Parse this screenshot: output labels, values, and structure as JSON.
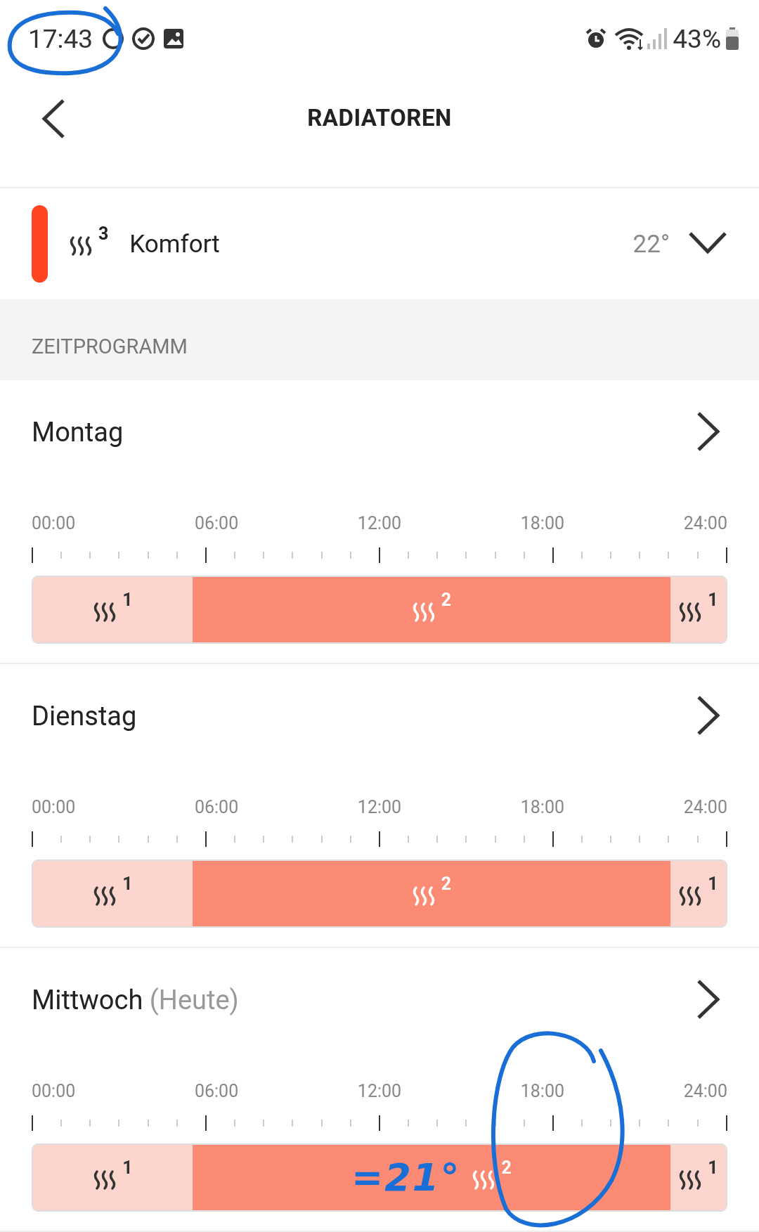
{
  "status_bar": {
    "time": "17:43",
    "battery": "43%"
  },
  "header": {
    "title": "RADIATOREN"
  },
  "current_mode": {
    "color": "#ff4422",
    "mode": "3",
    "label": "Komfort",
    "temperature": "22°",
    "expanded": false
  },
  "section_title": "ZEITPROGRAMM",
  "days": [
    {
      "day": "Montag",
      "time_labels": [
        "00:00",
        "06:00",
        "12:00",
        "18:00",
        "24:00"
      ],
      "segments": [
        {
          "kind": "early",
          "mode": "1"
        },
        {
          "kind": "day",
          "mode": "2"
        },
        {
          "kind": "late",
          "mode": "1"
        }
      ]
    },
    {
      "day": "Dienstag",
      "time_labels": [
        "00:00",
        "06:00",
        "12:00",
        "18:00",
        "24:00"
      ],
      "segments": [
        {
          "kind": "early",
          "mode": "1"
        },
        {
          "kind": "day",
          "mode": "2"
        },
        {
          "kind": "late",
          "mode": "1"
        }
      ]
    },
    {
      "day": "Mittwoch",
      "note": "(Heute)",
      "time_labels": [
        "00:00",
        "06:00",
        "12:00",
        "18:00",
        "24:00"
      ],
      "segments": [
        {
          "kind": "early",
          "mode": "1"
        },
        {
          "kind": "day",
          "mode": "2",
          "handwritten_note": "=21°"
        },
        {
          "kind": "late",
          "mode": "1"
        }
      ]
    }
  ]
}
